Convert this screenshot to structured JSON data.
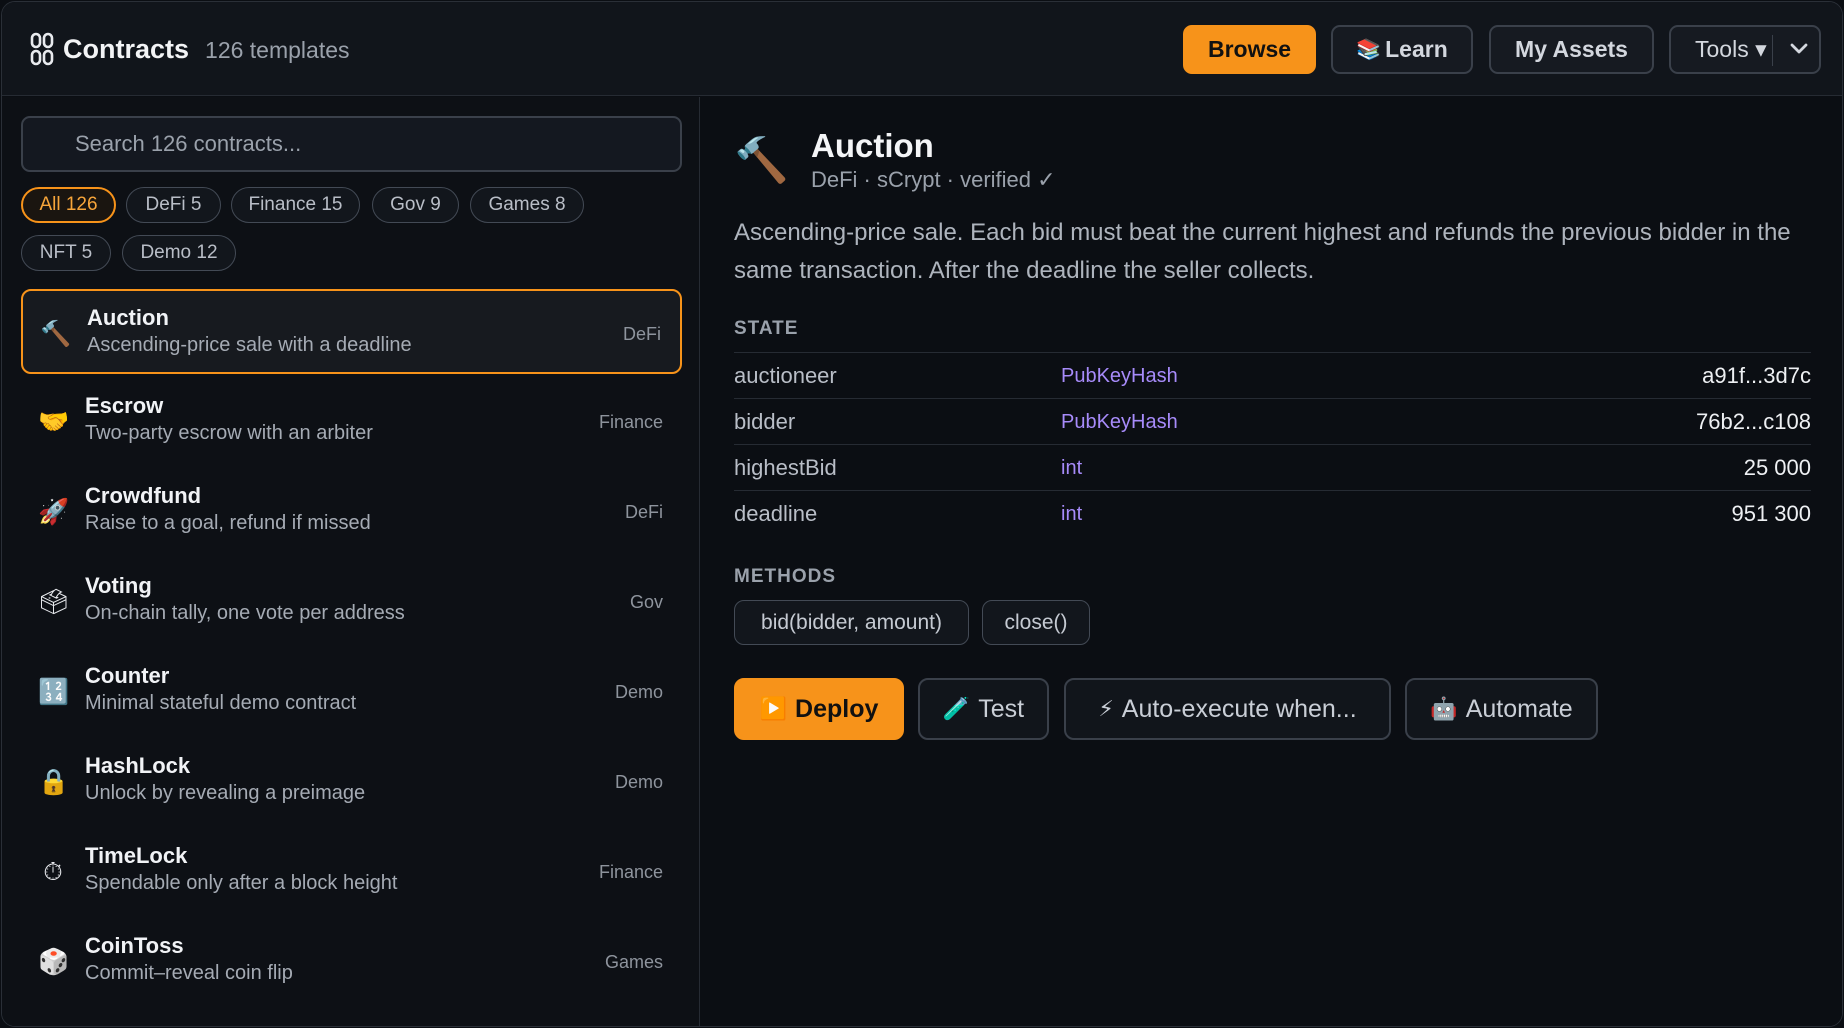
{
  "header": {
    "title": "Contracts",
    "template_count": "126 templates",
    "nav": {
      "browse": "Browse",
      "learn": "Learn",
      "my_assets": "My Assets",
      "tools": "Tools ▾"
    },
    "icons": {
      "brand": "link-chain-icon",
      "learn": "books-icon",
      "tools_chevron": "chevron-down-icon"
    },
    "accent_color": "#f7931a"
  },
  "search": {
    "placeholder": "Search 126 contracts..."
  },
  "filters": [
    "All 126",
    "DeFi 5",
    "Finance 15",
    "Gov 9",
    "Games 8",
    "NFT 5",
    "Demo 12"
  ],
  "contracts": [
    {
      "icon": "🔨",
      "name": "Auction",
      "desc": "Ascending-price sale with a deadline",
      "category": "DeFi"
    },
    {
      "icon": "🤝",
      "name": "Escrow",
      "desc": "Two-party escrow with an arbiter",
      "category": "Finance"
    },
    {
      "icon": "🚀",
      "name": "Crowdfund",
      "desc": "Raise to a goal, refund if missed",
      "category": "DeFi"
    },
    {
      "icon": "🗳",
      "name": "Voting",
      "desc": "On-chain tally, one vote per address",
      "category": "Gov"
    },
    {
      "icon": "🔢",
      "name": "Counter",
      "desc": "Minimal stateful demo contract",
      "category": "Demo"
    },
    {
      "icon": "🔒",
      "name": "HashLock",
      "desc": "Unlock by revealing a preimage",
      "category": "Demo"
    },
    {
      "icon": "⏱",
      "name": "TimeLock",
      "desc": "Spendable only after a block height",
      "category": "Finance"
    },
    {
      "icon": "🎲",
      "name": "CoinToss",
      "desc": "Commit–reveal coin flip",
      "category": "Games"
    }
  ],
  "detail": {
    "icon": "🔨",
    "title": "Auction",
    "meta": "DeFi · sCrypt · verified ✓",
    "description": "Ascending-price sale. Each bid must beat the current highest and refunds the previous bidder in the same transaction. After the deadline the seller collects.",
    "state_label": "STATE",
    "state": [
      {
        "key": "auctioneer",
        "type": "PubKeyHash",
        "value": "a91f...3d7c"
      },
      {
        "key": "bidder",
        "type": "PubKeyHash",
        "value": "76b2...c108"
      },
      {
        "key": "highestBid",
        "type": "int",
        "value": "25 000"
      },
      {
        "key": "deadline",
        "type": "int",
        "value": "951 300"
      }
    ],
    "methods_label": "METHODS",
    "methods": [
      "bid(bidder, amount)",
      "close()"
    ],
    "actions": {
      "deploy": "Deploy",
      "test": "Test",
      "auto": "Auto-execute when...",
      "automate": "Automate"
    },
    "action_icons": {
      "deploy": "▶️",
      "test": "🧪",
      "auto": "⚡",
      "automate": "🤖"
    }
  }
}
